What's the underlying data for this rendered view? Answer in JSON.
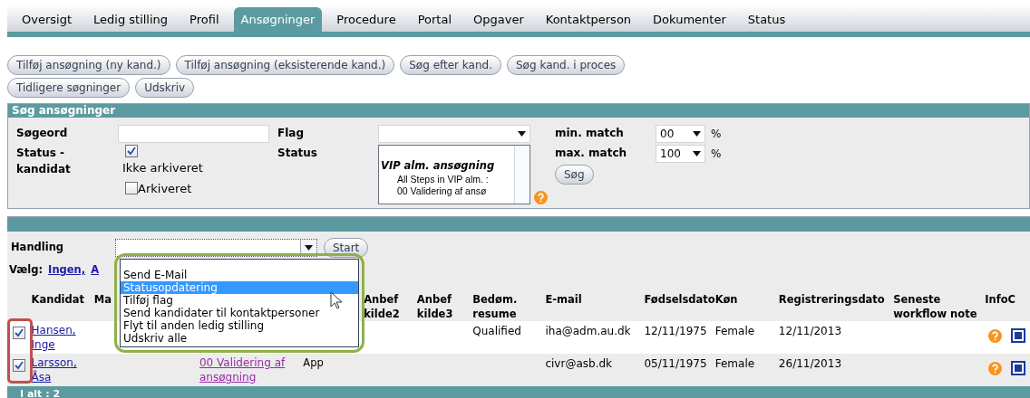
{
  "tabs": [
    {
      "label": "Oversigt",
      "selected": false
    },
    {
      "label": "Ledig stilling",
      "selected": false
    },
    {
      "label": "Profil",
      "selected": false
    },
    {
      "label": "Ansøgninger",
      "selected": true
    },
    {
      "label": "Procedure",
      "selected": false
    },
    {
      "label": "Portal",
      "selected": false
    },
    {
      "label": "Opgaver",
      "selected": false
    },
    {
      "label": "Kontaktperson",
      "selected": false
    },
    {
      "label": "Dokumenter",
      "selected": false
    },
    {
      "label": "Status",
      "selected": false
    }
  ],
  "buttons": [
    "Tilføj ansøgning (ny kand.)",
    "Tilføj ansøgning (eksisterende kand.)",
    "Søg efter kand.",
    "Søg kand. i proces",
    "Tidligere søgninger",
    "Udskriv"
  ],
  "search": {
    "title": "Søg ansøgninger",
    "keyword_label": "Søgeord",
    "flag_label": "Flag",
    "status_candidate_label": "Status - kandidat",
    "not_archived": {
      "label": "Ikke arkiveret",
      "checked": true
    },
    "archived": {
      "label": "Arkiveret",
      "checked": false
    },
    "status_label": "Status",
    "status_list": {
      "group": "VIP alm. ansøgning",
      "items": [
        "All Steps in VIP alm. :",
        "00 Validering af ansø"
      ]
    },
    "min_match_label": "min. match",
    "min_match": "00",
    "max_match_label": "max. match",
    "max_match": "100",
    "percent": "%",
    "search_button": "Søg"
  },
  "results": {
    "action_label": "Handling",
    "start_button": "Start",
    "choose_label": "Vælg:",
    "choose_links": [
      "Ingen,",
      "A"
    ],
    "dropdown": [
      {
        "label": "Send E-Mail",
        "selected": false
      },
      {
        "label": "Statusopdatering",
        "selected": true
      },
      {
        "label": "Tilføj flag",
        "selected": false
      },
      {
        "label": "Send kandidater til kontaktpersoner",
        "selected": false
      },
      {
        "label": "Flyt til anden ledig stilling",
        "selected": false
      },
      {
        "label": "Udskriv alle",
        "selected": false
      }
    ],
    "columns": {
      "candidate": "Kandidat",
      "column_2": "Ma",
      "kilde2": "Anbef kilde2",
      "kilde3": "Anbef kilde3",
      "resume": "Bedøm. resume",
      "email": "E-mail",
      "birthdate": "Fødselsdato",
      "gender": "Køn",
      "registered": "Registreringsdato",
      "note": "Seneste workflow note",
      "info": "InfoC"
    },
    "rows": [
      {
        "checked": true,
        "candidate": "Hansen, Inge",
        "resume": "Qualified",
        "email": "iha@adm.au.dk",
        "birthdate": "12/11/1975",
        "gender": "Female",
        "registered": "12/11/2013"
      },
      {
        "checked": true,
        "candidate": "Larsson, Åsa",
        "status": "00 Validering af ansøgning",
        "column_4": "App",
        "email": "civr@asb.dk",
        "birthdate": "05/11/1975",
        "gender": "Female",
        "registered": "26/11/2013"
      }
    ],
    "total": "I alt : 2"
  }
}
